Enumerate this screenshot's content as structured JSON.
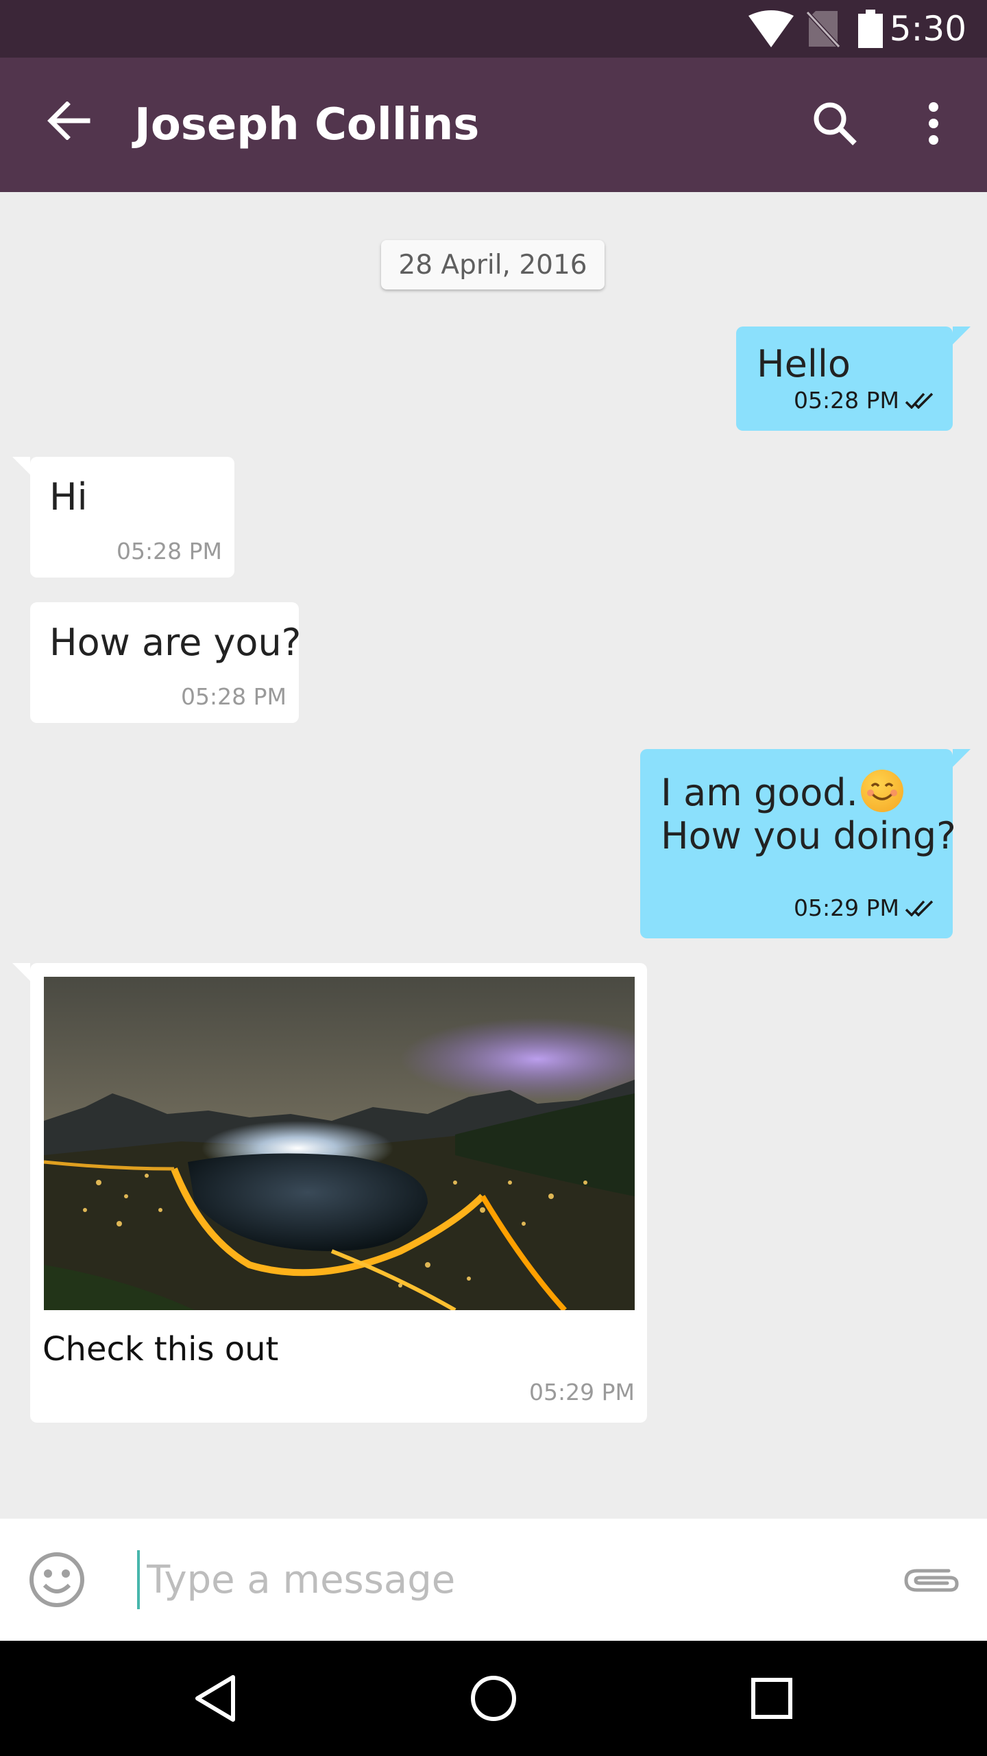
{
  "status_bar": {
    "time": "5:30",
    "icons": [
      "wifi-icon",
      "no-sim-icon",
      "battery-icon"
    ]
  },
  "app_bar": {
    "title": "Joseph Collins",
    "icons": [
      "back-arrow-icon",
      "search-icon",
      "more-vert-icon"
    ]
  },
  "chat": {
    "date": "28 April, 2016",
    "messages": [
      {
        "direction": "outgoing",
        "text": "Hello",
        "time": "05:28 PM",
        "status": "double-check-icon"
      },
      {
        "direction": "incoming",
        "text": "Hi",
        "time": "05:28 PM"
      },
      {
        "direction": "incoming",
        "text": "How are you?",
        "time": "05:28 PM"
      },
      {
        "direction": "outgoing",
        "text_line1": "I am good.",
        "emoji": "smiling-face-emoji",
        "text_line2": "How you doing?",
        "time": "05:29 PM",
        "status": "double-check-icon"
      },
      {
        "direction": "incoming",
        "image": "night-city-lake-photo",
        "caption": "Check this out",
        "time": "05:29 PM"
      }
    ]
  },
  "composer": {
    "placeholder": "Type a message",
    "value": "",
    "icons": [
      "emoji-icon",
      "attach-icon"
    ]
  },
  "nav_bar": {
    "icons": [
      "nav-back-icon",
      "nav-home-icon",
      "nav-recents-icon"
    ]
  },
  "colors": {
    "status_bar": "#3b2638",
    "app_bar": "#52354d",
    "outgoing_bubble": "#8be0fc",
    "incoming_bubble": "#ffffff",
    "chat_background": "#ededed",
    "cursor": "#48b6ac"
  }
}
